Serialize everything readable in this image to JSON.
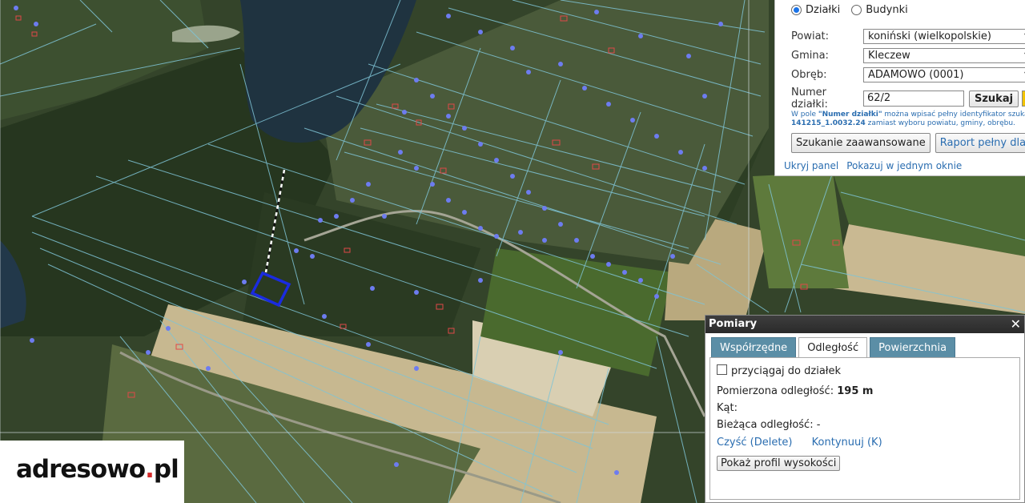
{
  "search": {
    "radio_dzialki": "Działki",
    "radio_budynki": "Budynki",
    "selected_mode": "Działki",
    "powiat_label": "Powiat:",
    "powiat_value": "koniński (wielkopolskie)",
    "gmina_label": "Gmina:",
    "gmina_value": "Kleczew",
    "obreb_label": "Obręb:",
    "obreb_value": "ADAMOWO (0001)",
    "numer_label": "Numer działki:",
    "numer_value": "62/2",
    "szukaj_button": "Szukaj",
    "hint_pre": "W pole ",
    "hint_bold": "\"Numer działki\"",
    "hint_mid": " można wpisać pełny identyfikator szuka",
    "hint_bold2": "141215_1.0032.24",
    "hint_post": " zamiast wyboru powiatu, gminy, obrębu.",
    "advanced_button": "Szukanie zaawansowane",
    "report_button": "Raport pełny dla dział",
    "hide_link": "Ukryj panel",
    "single_window_link": "Pokazuj w jednym oknie"
  },
  "measure": {
    "title": "Pomiary",
    "close_icon": "close-icon",
    "tabs": [
      "Współrzędne",
      "Odległość",
      "Powierzchnia"
    ],
    "active_tab": "Odległość",
    "snap_label": "przyciągaj do działek",
    "measured_label": "Pomierzona odległość:",
    "measured_value": "195 m",
    "angle_label": "Kąt:",
    "current_label": "Bieżąca odległość: -",
    "clear_link": "Czyść (Delete)",
    "continue_link": "Kontynuuj (K)",
    "profile_button": "Pokaż profil wysokości"
  },
  "logo": {
    "part1": "adresowo",
    "dot": ".",
    "part2": "pl"
  },
  "colors": {
    "parcel_lines": "#7fc4d6",
    "selected_parcel": "#1a2be0",
    "building_points": "#6d7cf0",
    "link": "#2a6db0",
    "tab": "#5b8ea6"
  }
}
